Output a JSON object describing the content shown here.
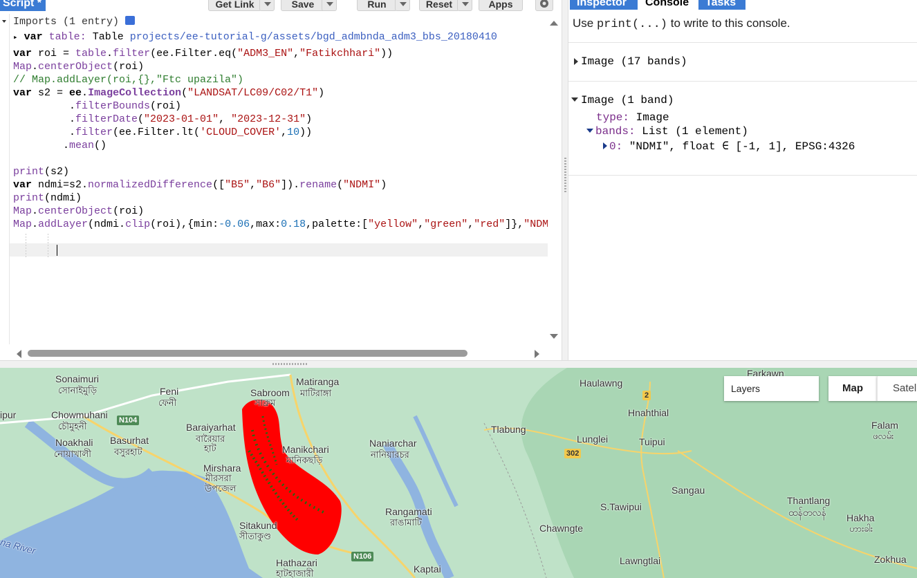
{
  "toolbar": {
    "title": "Script *",
    "get_link": "Get Link",
    "save": "Save",
    "run": "Run",
    "reset": "Reset",
    "apps": "Apps"
  },
  "imports": {
    "header": "Imports (1 entry)",
    "var_kw": "var",
    "var_name": "table",
    "type": "Table",
    "path": "projects/ee-tutorial-g/assets/bgd_admbnda_adm3_bbs_20180410"
  },
  "right_tabs": {
    "inspector": "Inspector",
    "console": "Console",
    "tasks": "Tasks"
  },
  "console": {
    "hint_pre": "Use ",
    "hint_code": "print(...)",
    "hint_post": " to write to this console.",
    "out1": "Image (17 bands)",
    "out2": "Image (1 band)",
    "type_key": "type:",
    "type_val": "Image",
    "bands_key": "bands:",
    "bands_val": "List (1 element)",
    "band0_key": "0:",
    "band0_val": "\"NDMI\", float ∈ [-1, 1], EPSG:4326"
  },
  "map": {
    "layers_label": "Layers",
    "map_btn": "Map",
    "sat_btn": "Satellite",
    "labels": [
      "Sonaimuri",
      "সোনাইমুড়ি",
      "Feni",
      "ফেনী",
      "Sabroom",
      "সাব্রুম",
      "Matiranga",
      "মাটিরাঙ্গা",
      "Haulawng",
      "Farkawn",
      "Chowmuhani",
      "চৌমুহনী",
      "Baraiyarhat",
      "বারৈয়ার",
      "হাট",
      "Hnahthial",
      "Noakhali",
      "নোয়াখালী",
      "Basurhat",
      "বসুরহাট",
      "Manikchari",
      "মানিকছড়ি",
      "Naniarchar",
      "নানিয়ারচর",
      "Tlabung",
      "Lunglei",
      "Tuipui",
      "Falam",
      "ဖလမ်း",
      "Mirshara",
      "মীরসরা",
      "উপজেল",
      "Sangau",
      "Thantlang",
      "ထန်တလန်",
      "Hakha",
      "ဟားခါး",
      "S.Tawipui",
      "Rangamati",
      "রাঙামাটি",
      "Sitakund",
      "সীতাকুণ্ড",
      "Chawngte",
      "Lawngtlai",
      "Zokhua",
      "Hathazari",
      "হাটহাজারী",
      "Kaptai",
      "ipur",
      "na River"
    ],
    "roads": [
      "N104",
      "2",
      "302",
      "N106"
    ],
    "colors": {
      "water": "#8fb4e0",
      "land": "#bfe2c8",
      "ndmi_red": "#ff0000",
      "ndmi_green": "#1f6b12"
    }
  }
}
